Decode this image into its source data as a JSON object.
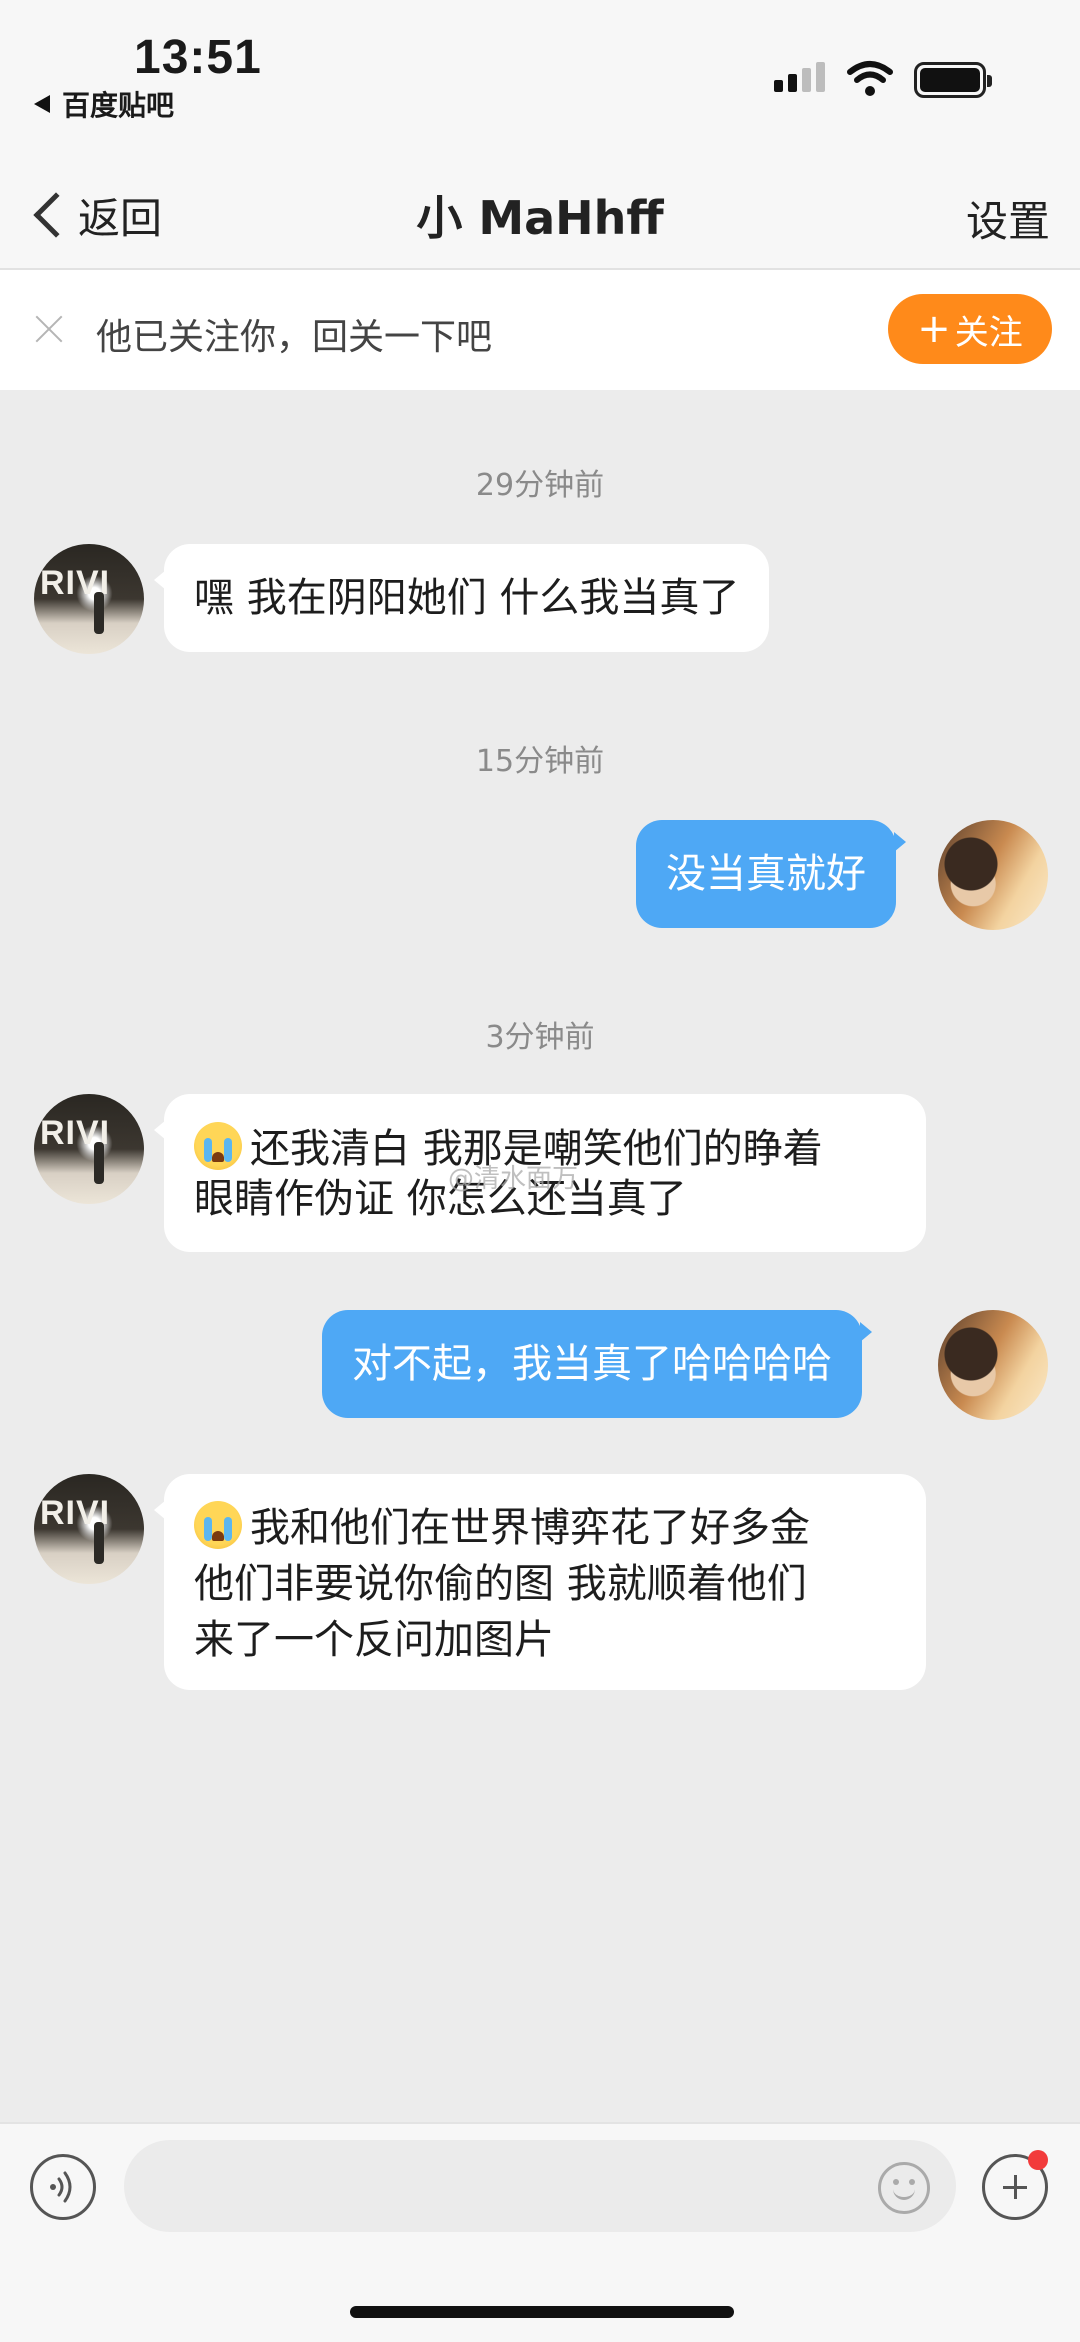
{
  "status_bar": {
    "time": "13:51",
    "back_app": "百度贴吧",
    "signal_icon": "cellular-signal-icon",
    "wifi_icon": "wifi-icon",
    "battery_icon": "battery-icon"
  },
  "nav": {
    "back_label": "返回",
    "title": "小 MaHhff",
    "settings_label": "设置"
  },
  "follow_banner": {
    "text": "他已关注你，回关一下吧",
    "button_plus": "+",
    "button_label": "关注",
    "accent_color": "#ff8a1a"
  },
  "chat": {
    "timestamps": [
      "29分钟前",
      "15分钟前",
      "3分钟前"
    ],
    "messages": [
      {
        "side": "left",
        "text": "嘿 我在阴阳她们 什么我当真了"
      },
      {
        "side": "right",
        "text": "没当真就好"
      },
      {
        "side": "left",
        "emoji": "crying-face-emoji",
        "line1": "还我清白 我那是嘲笑他们的睁着",
        "line2": "眼睛作伪证 你怎么还当真了"
      },
      {
        "side": "right",
        "text": "对不起，我当真了哈哈哈哈"
      },
      {
        "side": "left",
        "emoji": "crying-face-emoji",
        "line1": "我和他们在世界博弈花了好多金",
        "line2": "他们非要说你偷的图 我就顺着他们",
        "line3": "来了一个反问加图片"
      }
    ],
    "other_avatar_text": "RIVI",
    "out_bubble_color": "#4ea8f5",
    "watermark": "@清水面万"
  },
  "input_bar": {
    "placeholder": "",
    "voice_icon": "voice-icon",
    "emoji_icon": "emoji-icon",
    "plus_icon": "plus-icon"
  }
}
